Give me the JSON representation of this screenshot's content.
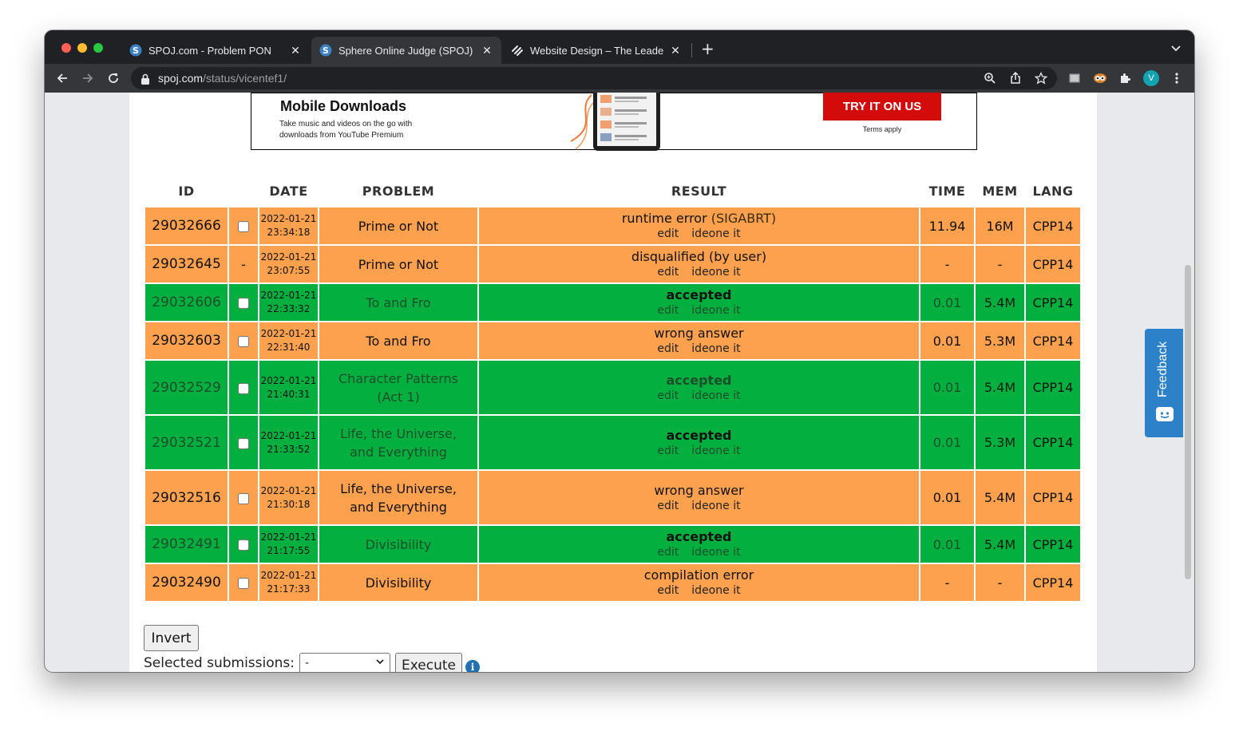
{
  "browser": {
    "tabs": [
      {
        "title": "SPOJ.com - Problem PON",
        "active": false
      },
      {
        "title": "Sphere Online Judge (SPOJ) - ",
        "active": true
      },
      {
        "title": "Website Design – The Leader i",
        "active": false
      }
    ],
    "url_host": "spoj.com",
    "url_path": "/status/vicentef1/",
    "profile_initial": "V"
  },
  "ad": {
    "title": "Mobile Downloads",
    "description": "Take music and videos on the go with downloads from YouTube Premium",
    "cta": "TRY IT ON US",
    "terms": "Terms apply"
  },
  "table": {
    "headers": {
      "id": "ID",
      "date": "DATE",
      "problem": "PROBLEM",
      "result": "RESULT",
      "time": "TIME",
      "mem": "MEM",
      "lang": "LANG"
    },
    "edit_label": "edit",
    "ideone_label": "ideone it",
    "rows": [
      {
        "id": "29032666",
        "check": "checkbox",
        "date": "2022-01-21",
        "time_of_day": "23:34:18",
        "problem": "Prime or Not",
        "result": "runtime error",
        "result_detail": "(SIGABRT)",
        "time": "11.94",
        "mem": "16M",
        "lang": "CPP14",
        "color": "orange"
      },
      {
        "id": "29032645",
        "check": "-",
        "date": "2022-01-21",
        "time_of_day": "23:07:55",
        "problem": "Prime or Not",
        "result": "disqualified (by user)",
        "time": "-",
        "mem": "-",
        "lang": "CPP14",
        "color": "orange"
      },
      {
        "id": "29032606",
        "check": "checkbox",
        "date": "2022-01-21",
        "time_of_day": "22:33:32",
        "problem": "To and Fro",
        "result": "accepted",
        "time": "0.01",
        "mem": "5.4M",
        "lang": "CPP14",
        "color": "green"
      },
      {
        "id": "29032603",
        "check": "checkbox",
        "date": "2022-01-21",
        "time_of_day": "22:31:40",
        "problem": "To and Fro",
        "result": "wrong answer",
        "time": "0.01",
        "mem": "5.3M",
        "lang": "CPP14",
        "color": "orange"
      },
      {
        "id": "29032529",
        "check": "checkbox",
        "date": "2022-01-21",
        "time_of_day": "21:40:31",
        "problem": "Character Patterns (Act 1)",
        "result": "accepted",
        "time": "0.01",
        "mem": "5.4M",
        "lang": "CPP14",
        "color": "green"
      },
      {
        "id": "29032521",
        "check": "checkbox",
        "date": "2022-01-21",
        "time_of_day": "21:33:52",
        "problem": "Life, the Universe, and Everything",
        "result": "accepted",
        "time": "0.01",
        "mem": "5.3M",
        "lang": "CPP14",
        "color": "green"
      },
      {
        "id": "29032516",
        "check": "checkbox",
        "date": "2022-01-21",
        "time_of_day": "21:30:18",
        "problem": "Life, the Universe, and Everything",
        "result": "wrong answer",
        "time": "0.01",
        "mem": "5.4M",
        "lang": "CPP14",
        "color": "orange"
      },
      {
        "id": "29032491",
        "check": "checkbox",
        "date": "2022-01-21",
        "time_of_day": "21:17:55",
        "problem": "Divisibility",
        "result": "accepted",
        "time": "0.01",
        "mem": "5.4M",
        "lang": "CPP14",
        "color": "green"
      },
      {
        "id": "29032490",
        "check": "checkbox",
        "date": "2022-01-21",
        "time_of_day": "21:17:33",
        "problem": "Divisibility",
        "result": "compilation error",
        "time": "-",
        "mem": "-",
        "lang": "CPP14",
        "color": "orange"
      }
    ]
  },
  "controls": {
    "invert_label": "Invert",
    "selected_label": "Selected submissions:",
    "select_value": "-",
    "execute_label": "Execute"
  },
  "feedback_label": "Feedback",
  "colors": {
    "orange_row": "#fda14e",
    "green_row": "#03b03f",
    "cta_red": "#d40b0b",
    "feedback_blue": "#2d81c9"
  }
}
